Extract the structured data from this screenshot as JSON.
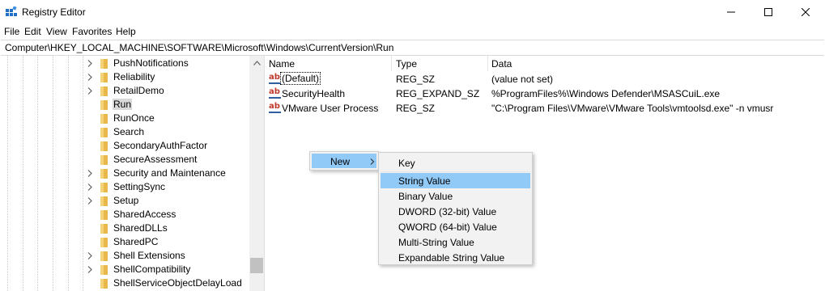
{
  "window": {
    "title": "Registry Editor"
  },
  "menubar": {
    "items": [
      "File",
      "Edit",
      "View",
      "Favorites",
      "Help"
    ]
  },
  "address": {
    "path": "Computer\\HKEY_LOCAL_MACHINE\\SOFTWARE\\Microsoft\\Windows\\CurrentVersion\\Run"
  },
  "tree": {
    "items": [
      {
        "label": "PushNotifications",
        "expandable": true
      },
      {
        "label": "Reliability",
        "expandable": true
      },
      {
        "label": "RetailDemo",
        "expandable": true
      },
      {
        "label": "Run",
        "expandable": false,
        "selected": true
      },
      {
        "label": "RunOnce",
        "expandable": false
      },
      {
        "label": "Search",
        "expandable": false
      },
      {
        "label": "SecondaryAuthFactor",
        "expandable": false
      },
      {
        "label": "SecureAssessment",
        "expandable": false
      },
      {
        "label": "Security and Maintenance",
        "expandable": true
      },
      {
        "label": "SettingSync",
        "expandable": true
      },
      {
        "label": "Setup",
        "expandable": true
      },
      {
        "label": "SharedAccess",
        "expandable": false
      },
      {
        "label": "SharedDLLs",
        "expandable": false
      },
      {
        "label": "SharedPC",
        "expandable": false
      },
      {
        "label": "Shell Extensions",
        "expandable": true
      },
      {
        "label": "ShellCompatibility",
        "expandable": true
      },
      {
        "label": "ShellServiceObjectDelayLoad",
        "expandable": false
      }
    ]
  },
  "list": {
    "columns": [
      "Name",
      "Type",
      "Data"
    ],
    "rows": [
      {
        "name": "(Default)",
        "type": "REG_SZ",
        "data": "(value not set)"
      },
      {
        "name": "SecurityHealth",
        "type": "REG_EXPAND_SZ",
        "data": "%ProgramFiles%\\Windows Defender\\MSASCuiL.exe"
      },
      {
        "name": "VMware User Process",
        "type": "REG_SZ",
        "data": "\"C:\\Program Files\\VMware\\VMware Tools\\vmtoolsd.exe\" -n vmusr"
      }
    ]
  },
  "context_menu": {
    "new_label": "New",
    "submenu": [
      "Key",
      "String Value",
      "Binary Value",
      "DWORD (32-bit) Value",
      "QWORD (64-bit) Value",
      "Multi-String Value",
      "Expandable String Value"
    ],
    "highlighted": "String Value"
  },
  "colors": {
    "highlight": "#91c9f7",
    "selection": "#d9d9d9",
    "folder": "#e8b84a",
    "menu_bg": "#f2f2f2"
  },
  "icons": {
    "app": "registry-editor-icon",
    "folder": "folder-icon",
    "value": "string-value-icon",
    "chevron": "chevron-right-icon"
  }
}
